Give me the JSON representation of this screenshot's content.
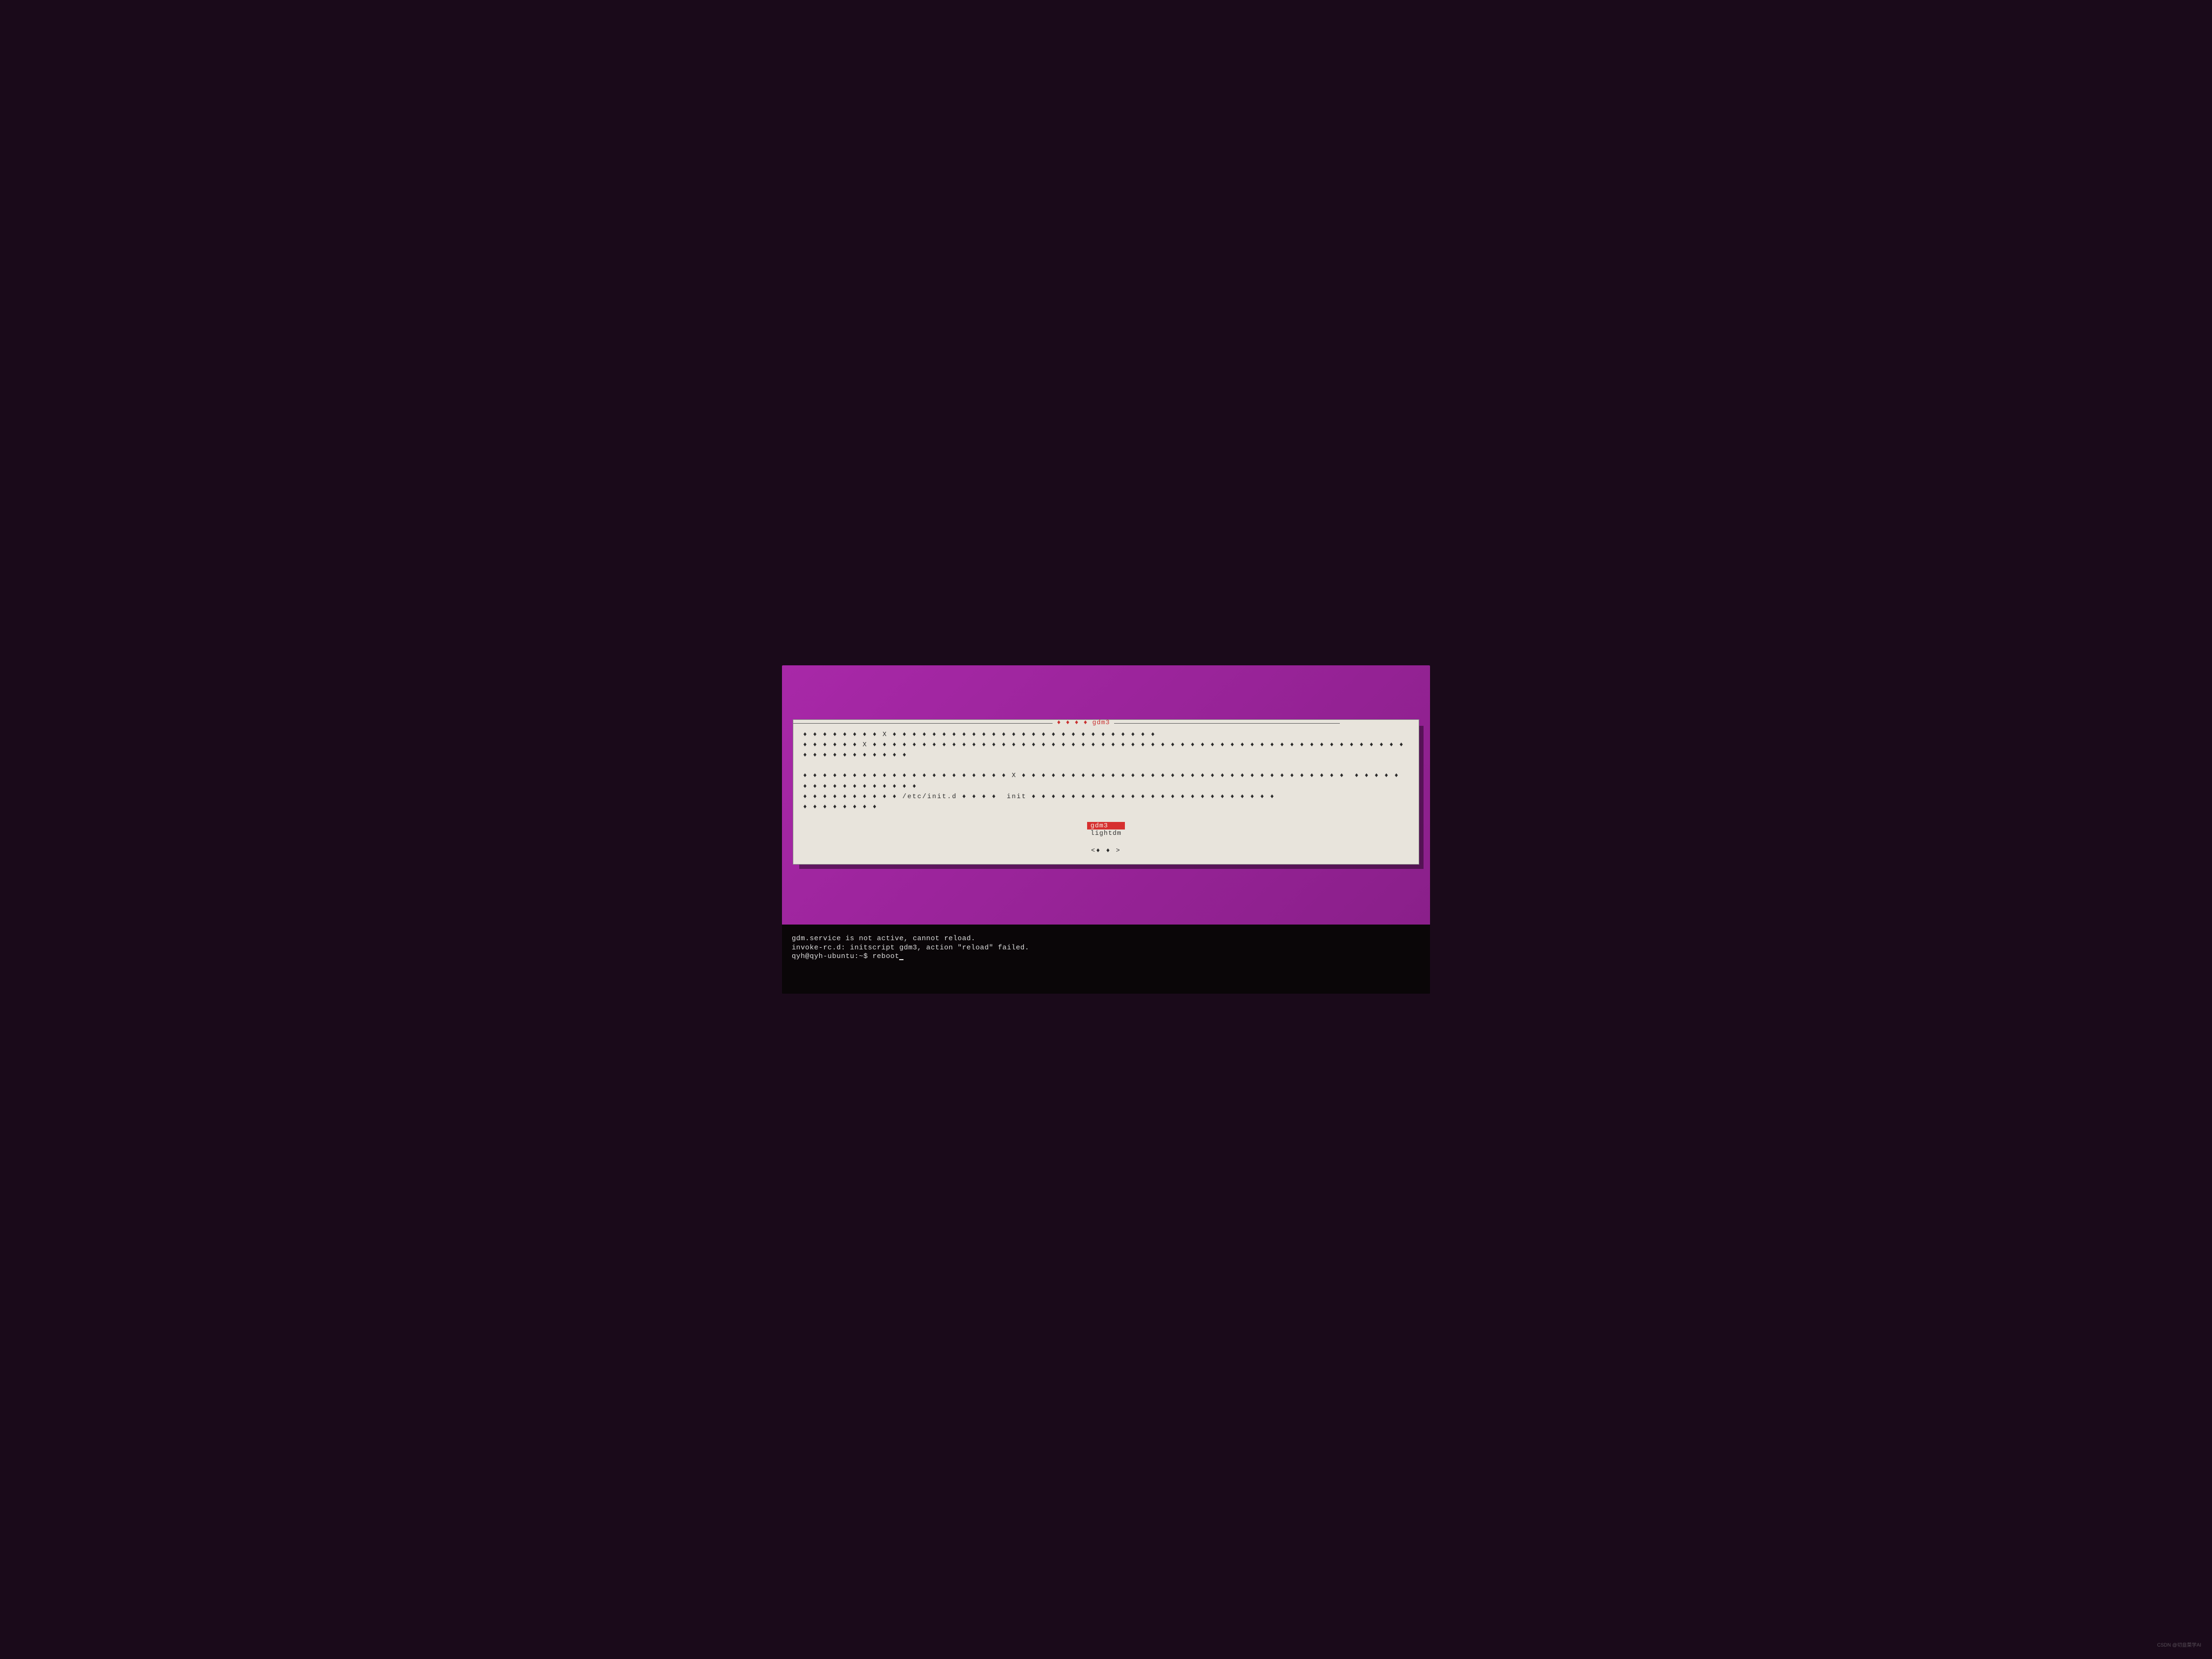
{
  "dialog": {
    "title": "♦ ♦ ♦ ♦  gdm3",
    "body_line1": "♦ ♦ ♦ ♦ ♦ ♦ ♦ ♦ X ♦ ♦ ♦ ♦ ♦ ♦ ♦ ♦ ♦ ♦ ♦ ♦ ♦ ♦ ♦ ♦ ♦ ♦ ♦ ♦ ♦ ♦ ♦ ♦ ♦ ♦ ♦",
    "body_line2": "♦ ♦ ♦ ♦ ♦ ♦ X ♦ ♦ ♦ ♦ ♦ ♦ ♦ ♦ ♦ ♦ ♦ ♦ ♦ ♦ ♦ ♦ ♦ ♦ ♦ ♦ ♦ ♦ ♦ ♦ ♦ ♦ ♦ ♦ ♦ ♦ ♦ ♦ ♦ ♦ ♦ ♦ ♦ ♦ ♦ ♦ ♦ ♦ ♦ ♦ ♦ ♦ ♦ ♦ ♦ ♦ ♦ ♦ ♦ ♦ ♦ ♦ ♦ ♦ ♦ ♦ ♦ ♦ ♦ ♦ ♦",
    "body_line3": "♦ ♦ ♦ ♦ ♦ ♦ ♦ ♦ ♦ ♦ ♦ ♦ ♦ ♦ ♦ ♦ ♦ ♦ ♦ ♦ ♦ X ♦ ♦ ♦ ♦ ♦ ♦ ♦ ♦ ♦ ♦ ♦ ♦ ♦ ♦ ♦ ♦ ♦ ♦ ♦ ♦ ♦ ♦ ♦ ♦ ♦ ♦ ♦ ♦ ♦ ♦ ♦ ♦ ♦  ♦ ♦ ♦ ♦ ♦ ♦ ♦ ♦ ♦ ♦ ♦ ♦ ♦ ♦ ♦ ♦ ♦",
    "body_line4": "♦ ♦ ♦ ♦ ♦ ♦ ♦ ♦ ♦ ♦ /etc/init.d ♦ ♦ ♦ ♦  init ♦ ♦ ♦ ♦ ♦ ♦ ♦ ♦ ♦ ♦ ♦ ♦ ♦ ♦ ♦ ♦ ♦ ♦ ♦ ♦ ♦ ♦ ♦ ♦ ♦",
    "body_line5": "♦ ♦ ♦ ♦ ♦ ♦ ♦ ♦",
    "options": {
      "selected": "gdm3",
      "unselected": "lightdm"
    },
    "ok_label": "<♦ ♦ >"
  },
  "terminal": {
    "line1": "gdm.service is not active, cannot reload.",
    "line2": "invoke-rc.d: initscript gdm3, action \"reload\" failed.",
    "prompt": "qyh@qyh-ubuntu:~$ ",
    "command": "reboot"
  },
  "watermark": "CSDN @切韭菜学AI"
}
